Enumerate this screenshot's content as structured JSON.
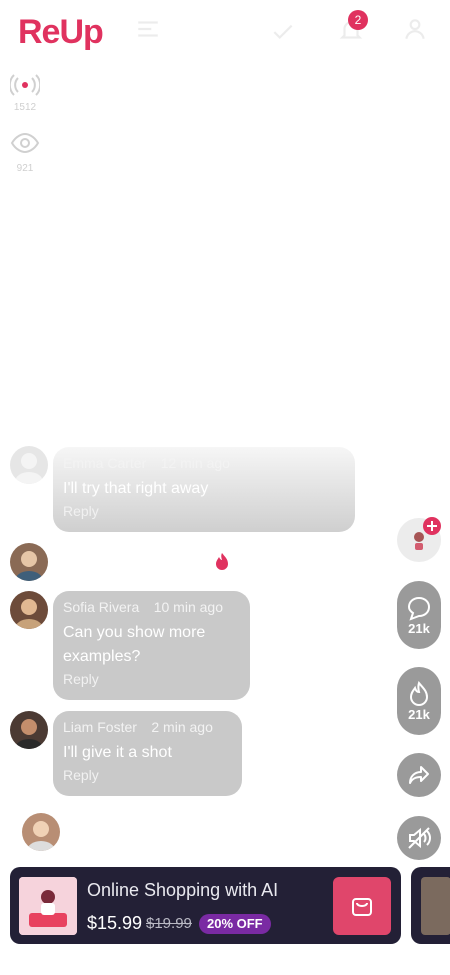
{
  "header": {
    "logo_text": "ReUp",
    "notification_count": "2"
  },
  "stats": {
    "live_viewers": "1512",
    "views": "921"
  },
  "comments": [
    {
      "name": "Emma Carter",
      "time": "12 min ago",
      "text": "I'll try that right away",
      "reply": "Reply"
    },
    {
      "name": "Sofia Rivera",
      "time": "10 min ago",
      "text": "Can you show more examples?",
      "reply": "Reply"
    },
    {
      "name": "Liam Foster",
      "time": "2 min ago",
      "text": "I'll give it a shot",
      "reply": "Reply"
    }
  ],
  "rail": {
    "comments_count": "21k",
    "likes_count": "21k"
  },
  "product": {
    "title": "Online Shopping with AI",
    "price": "$15.99",
    "old_price": "$19.99",
    "discount": "20% OFF"
  },
  "colors": {
    "brand": "#e0325f",
    "card_bg": "#232036",
    "discount_bg": "#7a2aa3",
    "bubble_bg": "#c9c9c9"
  }
}
